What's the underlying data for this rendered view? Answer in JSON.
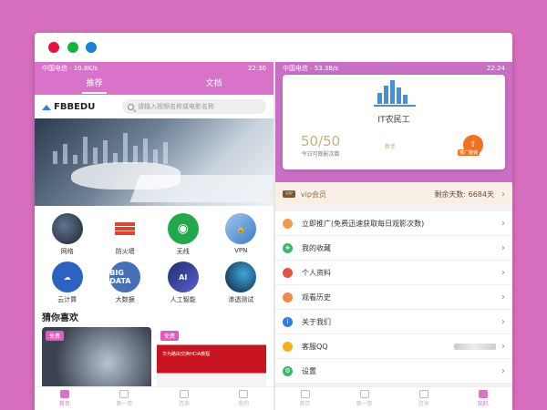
{
  "left": {
    "status": {
      "carrier": "中国电信",
      "speed": "10.8K/s",
      "time": "22:30"
    },
    "tabs": [
      "推荐",
      "文档"
    ],
    "logo": "FBBEDU",
    "search": {
      "placeholder": "请输入视频名称或电影名称"
    },
    "categories": [
      {
        "label": "网络",
        "icon": "network-icon",
        "glyph": ""
      },
      {
        "label": "防火墙",
        "icon": "firewall-icon",
        "glyph": ""
      },
      {
        "label": "无线",
        "icon": "wifi-icon",
        "glyph": "◉"
      },
      {
        "label": "VPN",
        "icon": "vpn-icon",
        "glyph": "🔒"
      },
      {
        "label": "云计算",
        "icon": "cloud-icon",
        "glyph": "☁"
      },
      {
        "label": "大数据",
        "icon": "bigdata-icon",
        "glyph": "BIG DATA"
      },
      {
        "label": "人工智能",
        "icon": "ai-icon",
        "glyph": "AI"
      },
      {
        "label": "渗透测试",
        "icon": "pentest-icon",
        "glyph": ""
      }
    ],
    "guess_title": "猜你喜欢",
    "cards": [
      {
        "badge": "免费",
        "caption": ""
      },
      {
        "badge": "免费",
        "caption": "华为路由交换HCIA教程"
      }
    ],
    "nav": [
      "首页",
      "第一单",
      "咨询",
      "我的"
    ]
  },
  "right": {
    "status": {
      "carrier": "中国电信",
      "speed": "53.3B/s",
      "time": "22:24"
    },
    "profile": {
      "name": "IT农民工",
      "views": "50/50",
      "views_label": "今日可观影次数",
      "level": "新手",
      "promo_label": "推广赚钱"
    },
    "vip": {
      "badge": "VIP",
      "label": "vip会员",
      "days": "剩余天数: 6684天"
    },
    "menu": [
      {
        "label": "立即推广(免费迅速获取每日观影次数)",
        "icon": "megaphone-icon",
        "color": "#f29a4b"
      },
      {
        "label": "我的收藏",
        "icon": "star-icon",
        "color": "#3bb56c"
      },
      {
        "label": "个人资料",
        "icon": "person-icon",
        "color": "#e5533d"
      },
      {
        "label": "观看历史",
        "icon": "history-icon",
        "color": "#f28a4b"
      },
      {
        "label": "关于我们",
        "icon": "info-icon",
        "color": "#2f7de0"
      },
      {
        "label": "客服QQ",
        "icon": "qq-icon",
        "color": "#f2b21c"
      },
      {
        "label": "设置",
        "icon": "gear-icon",
        "color": "#3bb56c"
      }
    ],
    "nav": [
      "首页",
      "第一单",
      "咨询",
      "我的"
    ]
  },
  "colors": {
    "background": "#d96fc0",
    "accent": "#d873c9",
    "vip_bg": "#f8efe6"
  }
}
